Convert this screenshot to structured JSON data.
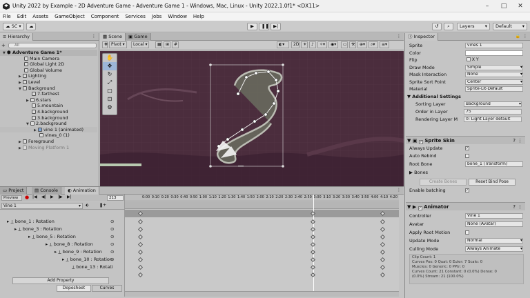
{
  "window": {
    "title": "Unity 2022 by Example - 2D Adventure Game - Adventure Game 1 - Windows, Mac, Linux - Unity 2022.1.0f1* <DX11>"
  },
  "menu": [
    "File",
    "Edit",
    "Assets",
    "GameObject",
    "Component",
    "Services",
    "Jobs",
    "Window",
    "Help"
  ],
  "toolbar": {
    "account": "SC",
    "layers": "Layers",
    "layout": "Default"
  },
  "hierarchy": {
    "tab": "Hierarchy",
    "add": "+",
    "search": "All",
    "items": [
      {
        "label": "Adventure Game 1*",
        "indent": 0,
        "bold": true
      },
      {
        "label": "Main Camera",
        "indent": 1
      },
      {
        "label": "Global Light 2D",
        "indent": 1
      },
      {
        "label": "Global Volume",
        "indent": 1
      },
      {
        "label": "Lighting",
        "indent": 1
      },
      {
        "label": "Level",
        "indent": 1
      },
      {
        "label": "Background",
        "indent": 1
      },
      {
        "label": "7.farthest",
        "indent": 2
      },
      {
        "label": "6.stars",
        "indent": 2
      },
      {
        "label": "5.mountain",
        "indent": 2
      },
      {
        "label": "4.background",
        "indent": 2
      },
      {
        "label": "3.background",
        "indent": 2
      },
      {
        "label": "2.background",
        "indent": 2
      },
      {
        "label": "vine 1 (animated)",
        "indent": 3
      },
      {
        "label": "vines_0 (1)",
        "indent": 3
      },
      {
        "label": "Foreground",
        "indent": 1
      },
      {
        "label": "Moving Platform 1",
        "indent": 1
      }
    ]
  },
  "scene": {
    "tab_scene": "Scene",
    "tab_game": "Game",
    "pivot": "Pivot",
    "local": "Local",
    "mode2d": "2D"
  },
  "inspector": {
    "tab": "Inspector",
    "sprite_renderer": [
      {
        "label": "Sprite",
        "value": "vines 1"
      },
      {
        "label": "Color",
        "value": ""
      },
      {
        "label": "Flip",
        "value": "X   Y"
      },
      {
        "label": "Draw Mode",
        "value": "Simple"
      },
      {
        "label": "Mask Interaction",
        "value": "None"
      },
      {
        "label": "Sprite Sort Point",
        "value": "Center"
      },
      {
        "label": "Material",
        "value": "Sprite-Lit-Default"
      }
    ],
    "additional_settings": "Additional Settings",
    "sorting": [
      {
        "label": "Sorting Layer",
        "value": "Background"
      },
      {
        "label": "Order in Layer",
        "value": "75"
      },
      {
        "label": "Rendering Layer M",
        "value": "0: Light Layer default"
      }
    ],
    "sprite_skin": {
      "title": "Sprite Skin",
      "always_update": "Always Update",
      "auto_rebind": "Auto Rebind",
      "root_bone_label": "Root Bone",
      "root_bone_value": "bone_1 (Transform)",
      "bones": "Bones",
      "create_bones": "Create Bones",
      "reset_bind": "Reset Bind Pose",
      "enable_batching": "Enable batching"
    },
    "animator": {
      "title": "Animator",
      "controller_label": "Controller",
      "controller_value": "Vine 1",
      "avatar_label": "Avatar",
      "avatar_value": "None (Avatar)",
      "apply_root": "Apply Root Motion",
      "update_mode_label": "Update Mode",
      "update_mode_value": "Normal",
      "culling_label": "Culling Mode",
      "culling_value": "Always Animate",
      "info": [
        "Clip Count: 1",
        "Curves Pos: 0 Quat: 0 Euler: 7 Scale: 0",
        "Muscles: 0 Generic: 0 PPtr: 0",
        "Curves Count: 21 Constant: 0 (0.0%) Dense: 0",
        "(0.0%) Stream: 21 (100.0%)"
      ]
    }
  },
  "animation": {
    "tabs": [
      "Project",
      "Console",
      "Animation"
    ],
    "preview": "Preview",
    "frame": "213",
    "clip": "Vine 1",
    "ruler": [
      "0:00",
      "0:10",
      "0:20",
      "0:30",
      "0:40",
      "0:50",
      "1:00",
      "1:10",
      "1:20",
      "1:30",
      "1:40",
      "1:50",
      "2:00",
      "2:10",
      "2:20",
      "2:30",
      "2:40",
      "2:50",
      "3:00",
      "3:10",
      "3:20",
      "3:30",
      "3:40",
      "3:50",
      "4:00",
      "4:10",
      "4:20",
      "4:30"
    ],
    "properties": [
      {
        "label": "bone_1 : Rotation",
        "indent": 0
      },
      {
        "label": "bone_3 : Rotation",
        "indent": 1
      },
      {
        "label": "bone_5 : Rotation",
        "indent": 2
      },
      {
        "label": "bone_8 : Rotation",
        "indent": 3
      },
      {
        "label": "bone_9 : Rotation",
        "indent": 4
      },
      {
        "label": "bone_10 : Rotation",
        "indent": 5
      },
      {
        "label": "bone_13 : Rotati",
        "indent": 6
      }
    ],
    "add_property": "Add Property",
    "bottom_tabs": [
      "Dopesheet",
      "Curves"
    ]
  }
}
